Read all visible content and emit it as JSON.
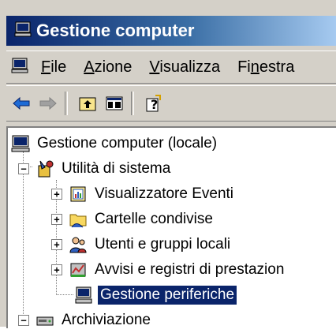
{
  "window": {
    "title": "Gestione computer"
  },
  "menu": [
    {
      "label": "File",
      "underline_index": 0
    },
    {
      "label": "Azione",
      "underline_index": 0
    },
    {
      "label": "Visualizza",
      "underline_index": 0
    },
    {
      "label": "Finestra",
      "underline_index": 2
    }
  ],
  "toolbar": {
    "buttons": [
      "back-icon",
      "forward-icon",
      "up-folder-icon",
      "show-hide-tree-icon",
      "help-icon"
    ]
  },
  "tree": {
    "root": "Gestione computer (locale)",
    "system_tools": "Utilità di sistema",
    "children": [
      "Visualizzatore Eventi",
      "Cartelle condivise",
      "Utenti e gruppi locali",
      "Avvisi e registri di prestazion",
      "Gestione periferiche"
    ],
    "storage": "Archiviazione",
    "selected": "Gestione periferiche"
  },
  "colors": {
    "title_gradient_start": "#0a246a",
    "selection": "#0a246a",
    "chrome": "#d4d0c8"
  }
}
